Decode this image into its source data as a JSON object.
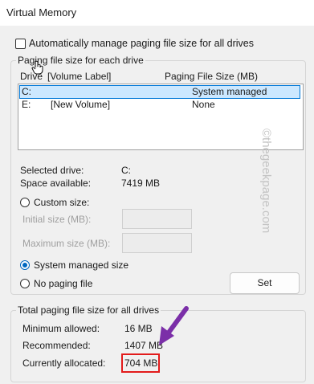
{
  "window": {
    "title": "Virtual Memory"
  },
  "auto_manage": {
    "label": "Automatically manage paging file size for all drives",
    "checked": false
  },
  "paging_group": {
    "legend": "Paging file size for each drive",
    "columns": {
      "drive": "Drive",
      "volume": "[Volume Label]",
      "size": "Paging File Size (MB)"
    },
    "rows": [
      {
        "drive": "C:",
        "volume": "",
        "size": "System managed",
        "selected": true
      },
      {
        "drive": "E:",
        "volume": "[New Volume]",
        "size": "None",
        "selected": false
      }
    ]
  },
  "selected_drive": {
    "label": "Selected drive:",
    "value": "C:"
  },
  "space_available": {
    "label": "Space available:",
    "value": "7419 MB"
  },
  "options": {
    "custom_size": "Custom size:",
    "initial_size": "Initial size (MB):",
    "maximum_size": "Maximum size (MB):",
    "system_managed": "System managed size",
    "no_paging": "No paging file",
    "selected_option": "system_managed"
  },
  "set_button": "Set",
  "totals_group": {
    "legend": "Total paging file size for all drives",
    "minimum": {
      "label": "Minimum allowed:",
      "value": "16 MB"
    },
    "recommended": {
      "label": "Recommended:",
      "value": "1407 MB"
    },
    "allocated": {
      "label": "Currently allocated:",
      "value": "704 MB"
    }
  },
  "watermark": "©thegeekpage.com",
  "colors": {
    "selection_bg": "#cce8ff",
    "selection_border": "#0078d7",
    "highlight_red": "#e21b1b",
    "arrow_purple": "#7b2fa8"
  }
}
